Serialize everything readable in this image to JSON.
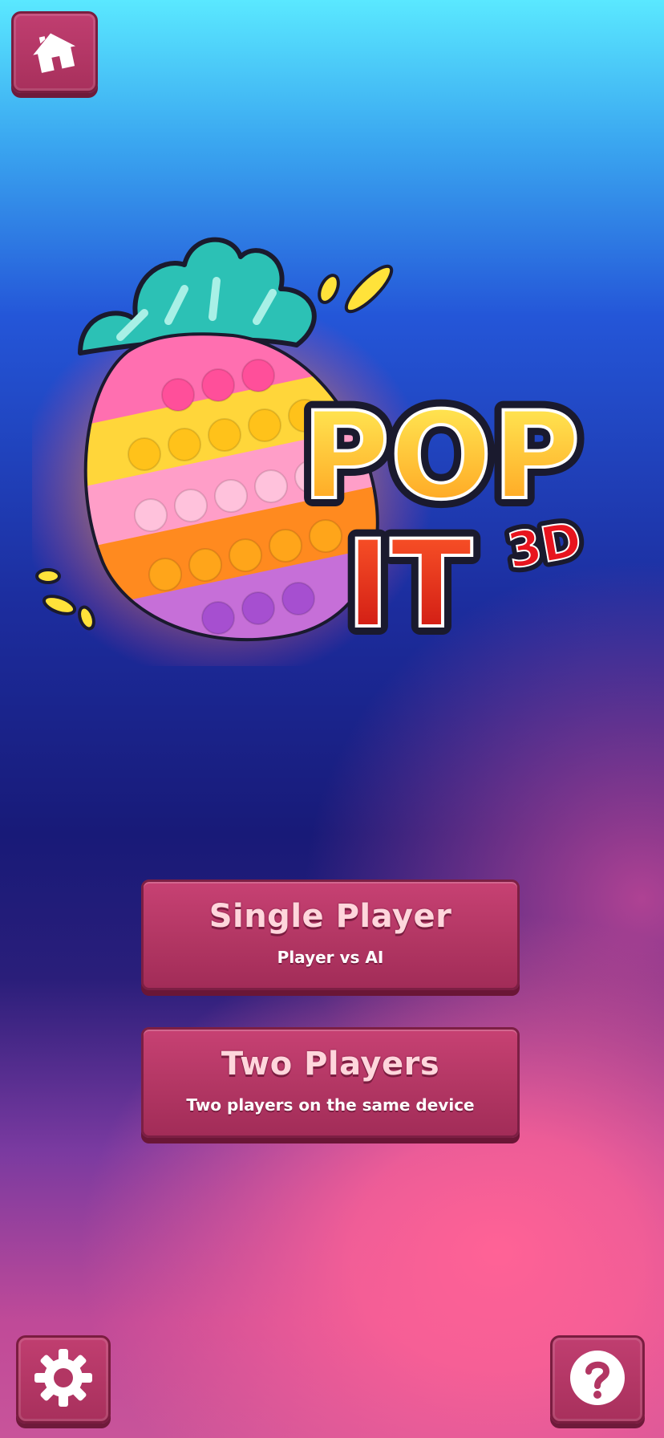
{
  "logo": {
    "word1": "POP",
    "word2": "IT",
    "badge": "3D",
    "image": "pineapple-pop-it-icon"
  },
  "menu": {
    "single": {
      "title": "Single Player",
      "subtitle": "Player vs AI"
    },
    "two": {
      "title": "Two Players",
      "subtitle": "Two players on the same device"
    }
  },
  "icons": {
    "home": "home-icon",
    "settings": "gear-icon",
    "help": "question-icon"
  },
  "colors": {
    "button": "#b23663",
    "button_border": "#7a1d40",
    "title_text": "#ffd6dc"
  }
}
